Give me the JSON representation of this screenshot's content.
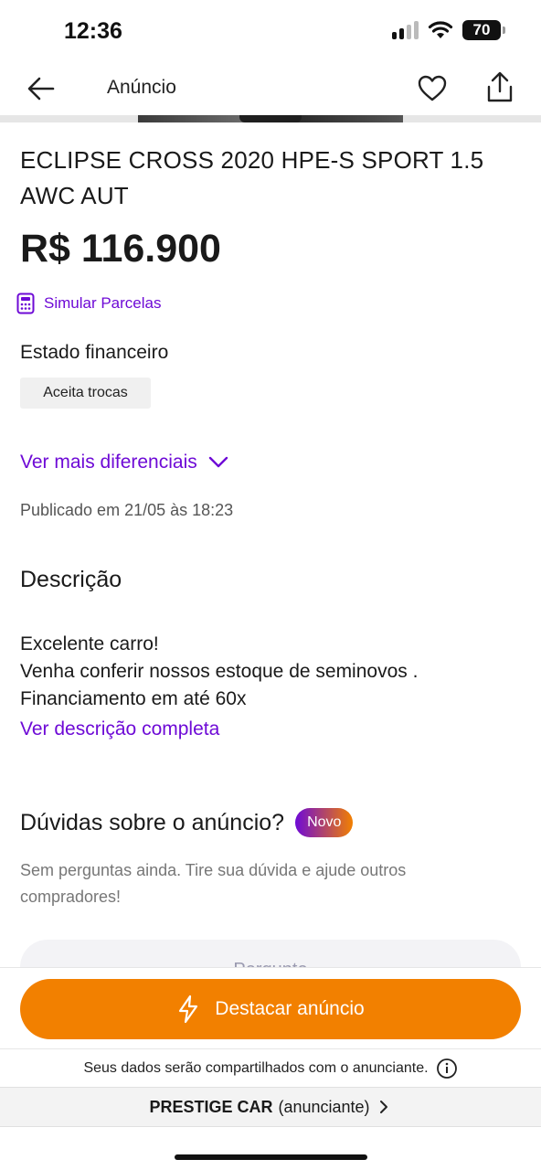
{
  "status_bar": {
    "time": "12:36",
    "battery": "70"
  },
  "topbar": {
    "title": "Anúncio"
  },
  "listing": {
    "title": "ECLIPSE CROSS 2020 HPE-S SPORT 1.5 AWC AUT",
    "price": "R$ 116.900",
    "simulate_label": "Simular Parcelas",
    "financial_state_label": "Estado financeiro",
    "chips": [
      "Aceita trocas"
    ],
    "more_features_label": "Ver mais diferenciais",
    "published": "Publicado em 21/05 às 18:23"
  },
  "description": {
    "heading": "Descrição",
    "lines": [
      "Excelente carro!",
      "Venha conferir nossos estoque de seminovos .",
      "Financiamento em até 60x"
    ],
    "full_link": "Ver descrição completa"
  },
  "questions": {
    "heading": "Dúvidas sobre o anúncio?",
    "badge": "Novo",
    "subtitle": "Sem perguntas ainda. Tire sua dúvida e ajude outros compradores!",
    "ask_peek_label": "Pergunte"
  },
  "bottom": {
    "cta_label": "Destacar anúncio",
    "privacy_text": "Seus dados serão compartilhados com o anunciante.",
    "seller_name": "PRESTIGE CAR",
    "seller_role": "(anunciante)"
  },
  "colors": {
    "accent_purple": "#6e0ad6",
    "cta_orange": "#f28000"
  },
  "icons": [
    "arrow-left-icon",
    "heart-icon",
    "share-icon",
    "calculator-icon",
    "chevron-down-icon",
    "lightning-icon",
    "info-icon",
    "chevron-right-icon"
  ]
}
